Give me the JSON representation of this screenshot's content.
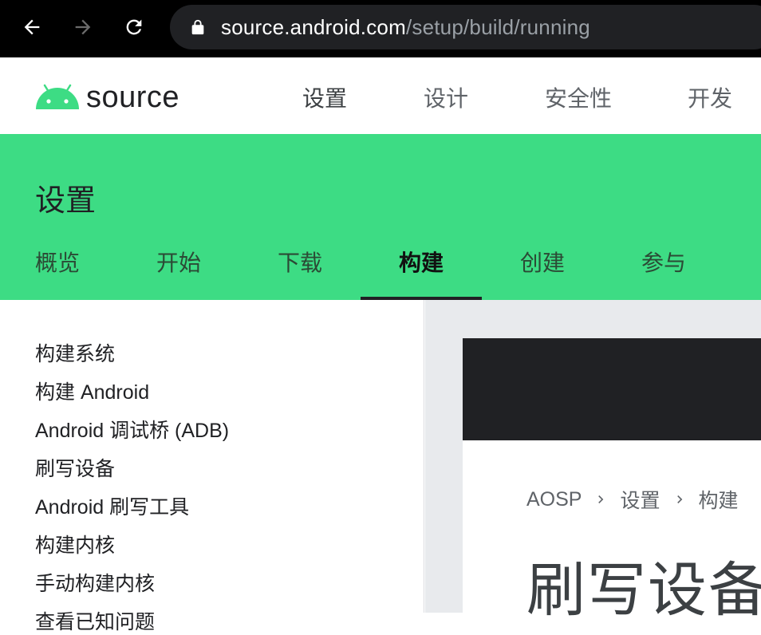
{
  "browser": {
    "url_host": "source.android.com",
    "url_path": "/setup/build/running"
  },
  "header": {
    "logo_text": "source",
    "nav": [
      "设置",
      "设计",
      "安全性",
      "开发"
    ]
  },
  "section": {
    "title": "设置",
    "tabs": [
      "概览",
      "开始",
      "下载",
      "构建",
      "创建",
      "参与"
    ],
    "active_tab": "构建"
  },
  "sidebar": {
    "items": [
      "构建系统",
      "构建 Android",
      "Android 调试桥 (ADB)",
      "刷写设备",
      "Android 刷写工具",
      "构建内核",
      "手动构建内核",
      "查看已知问题"
    ]
  },
  "content": {
    "breadcrumb": [
      "AOSP",
      "设置",
      "构建"
    ],
    "page_title": "刷写设备"
  },
  "colors": {
    "brand_green": "#3ddc84",
    "chrome_black": "#000000",
    "dark_card": "#202124"
  }
}
